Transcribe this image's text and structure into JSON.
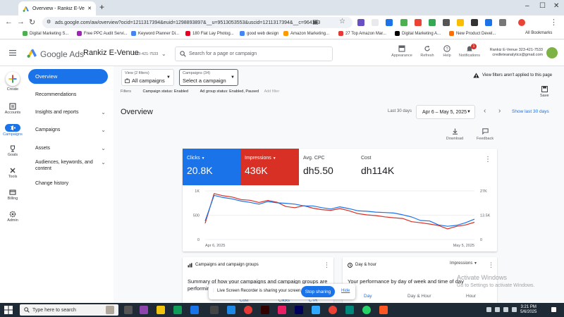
{
  "browser": {
    "tab_title": "Overview - Rankiz E-Venue - G",
    "url": "ads.google.com/aw/overview?ocid=1211317394&euid=1298893897&__u=9513053553&uscid=1211317394&__c=964163",
    "bookmarks": [
      {
        "label": "Digital Marketing S...",
        "color": "#4caf50"
      },
      {
        "label": "Free PPC Audit Servi...",
        "color": "#9c27b0"
      },
      {
        "label": "Keyword Planner Di...",
        "color": "#4285f4"
      },
      {
        "label": "180 Flat Lay Photog...",
        "color": "#e60023"
      },
      {
        "label": "good web design",
        "color": "#4285f4"
      },
      {
        "label": "Amazon Marketing...",
        "color": "#ff9900"
      },
      {
        "label": "27 Top Amazon Mar...",
        "color": "#e53935"
      },
      {
        "label": "Digital Marketing A...",
        "color": "#000000"
      },
      {
        "label": "New Product Devel...",
        "color": "#ff6f00"
      }
    ],
    "all_bookmarks": "All Bookmarks"
  },
  "header": {
    "brand": "Google Ads",
    "account_name": "Rankiz E-Venue",
    "account_id": "323-421-7533",
    "search_placeholder": "Search for a page or campaign",
    "tools": [
      "Appearance",
      "Refresh",
      "Help",
      "Notifications"
    ],
    "notification_count": "1",
    "user_line1": "323-421-7533 Rankiz E-Venue",
    "user_line2": "credleteanalytics@gmail.com"
  },
  "rail": [
    "Create",
    "Accounts",
    "Campaigns",
    "Goals",
    "Tools",
    "Billing",
    "Admin"
  ],
  "nav": {
    "overview": "Overview",
    "items": [
      "Recommendations",
      "Insights and reports",
      "Campaigns",
      "Assets",
      "Audiences, keywords, and content",
      "Change history"
    ]
  },
  "filters": {
    "view_label": "View (2 filters)",
    "view_value": "All campaigns",
    "campaign_label": "Campaigns (34)",
    "campaign_value": "Select a campaign",
    "warning": "View filters aren't applied to this page",
    "chips": [
      "Filters",
      "Campaign status: Enabled",
      "Ad group status: Enabled, Paused",
      "Add filter"
    ],
    "save": "Save"
  },
  "overview": {
    "title": "Overview",
    "range_label": "Last 30 days",
    "date_range": "Apr 6 – May 5, 2025",
    "show_last": "Show last 30 days",
    "download": "Download",
    "feedback": "Feedback"
  },
  "metrics": [
    {
      "name": "Clicks",
      "value": "20.8K"
    },
    {
      "name": "Impressions",
      "value": "436K"
    },
    {
      "name": "Avg. CPC",
      "value": "dh5.50"
    },
    {
      "name": "Cost",
      "value": "dh114K"
    }
  ],
  "chart_data": {
    "type": "line",
    "x_labels": [
      "Apr 6, 2025",
      "May 5, 2025"
    ],
    "y_left_ticks": [
      "1K",
      "500",
      "0"
    ],
    "y_right_ticks": [
      "27K",
      "13.5K",
      "0"
    ],
    "y_left_lim": [
      0,
      1100
    ],
    "y_right_lim": [
      0,
      27000
    ],
    "grid": true,
    "series": [
      {
        "name": "Clicks",
        "color": "#1a73e8",
        "axis": "left",
        "values": [
          420,
          1000,
          950,
          920,
          870,
          840,
          800,
          860,
          830,
          820,
          800,
          760,
          760,
          720,
          690,
          740,
          700,
          650,
          640,
          620,
          610,
          600,
          560,
          510,
          430,
          420,
          330,
          300,
          320,
          380,
          460
        ]
      },
      {
        "name": "Impressions",
        "color": "#d93025",
        "axis": "right",
        "values": [
          9000,
          25500,
          24300,
          23600,
          22200,
          21800,
          20600,
          21700,
          20700,
          18300,
          17700,
          18800,
          17400,
          16600,
          16200,
          17200,
          16000,
          14400,
          13700,
          13300,
          12600,
          12100,
          11700,
          9900,
          9300,
          8600,
          7800,
          5900,
          7300,
          8100,
          9600
        ]
      }
    ]
  },
  "cards": {
    "campaigns_title": "Campaigns and campaign groups",
    "campaigns_body": "Summary of how your campaigns and campaign groups are performing",
    "dayhour_title": "Day & hour",
    "dayhour_metric": "Impressions",
    "dayhour_body": "Your performance by day of week and time of day",
    "dayhour_tabs": [
      "Day",
      "Day & Hour",
      "Hour"
    ]
  },
  "watermark": {
    "line1": "Activate Windows",
    "line2": "Go to Settings to activate Windows."
  },
  "sharebar": {
    "text": "Live Screen Recorder is sharing your screen.",
    "stop": "Stop sharing",
    "hide": "Hide"
  },
  "behind": [
    "Cost",
    "Clicks",
    "CTR"
  ],
  "taskbar": {
    "search": "Type here to search",
    "time": "3:21 PM",
    "date": "5/6/2025"
  }
}
